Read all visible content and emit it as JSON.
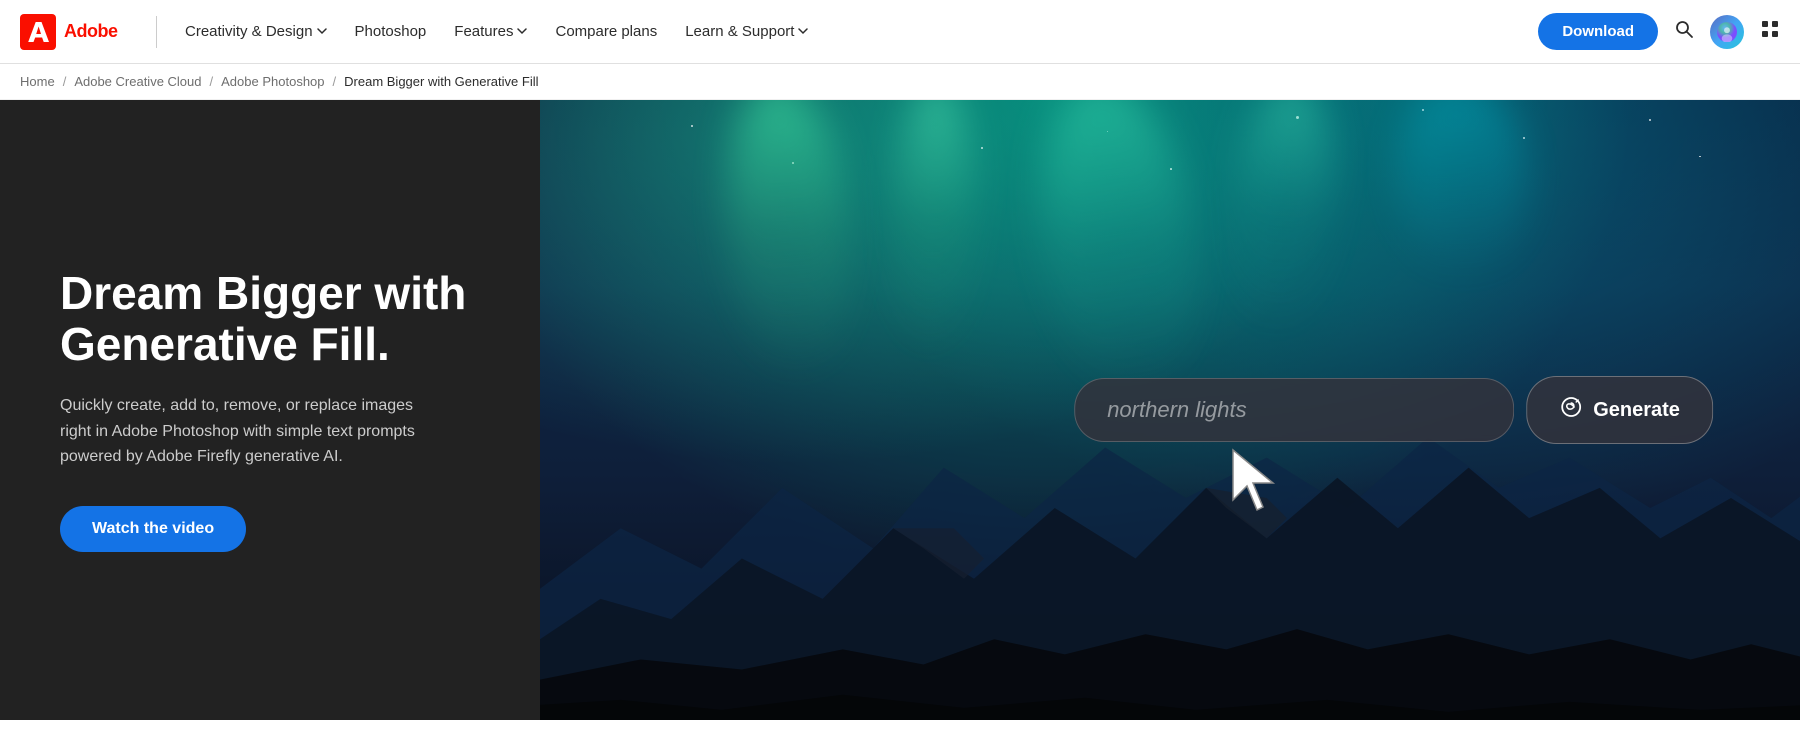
{
  "nav": {
    "brand": "Adobe",
    "divider": true,
    "links": [
      {
        "label": "Creativity & Design",
        "has_dropdown": true,
        "id": "creativity-design"
      },
      {
        "label": "Photoshop",
        "has_dropdown": false,
        "id": "photoshop"
      },
      {
        "label": "Features",
        "has_dropdown": true,
        "id": "features"
      },
      {
        "label": "Compare plans",
        "has_dropdown": false,
        "id": "compare-plans"
      },
      {
        "label": "Learn & Support",
        "has_dropdown": true,
        "id": "learn-support"
      }
    ],
    "download_label": "Download"
  },
  "breadcrumb": {
    "items": [
      {
        "label": "Home",
        "href": "#"
      },
      {
        "label": "Adobe Creative Cloud",
        "href": "#"
      },
      {
        "label": "Adobe Photoshop",
        "href": "#"
      },
      {
        "label": "Dream Bigger with Generative Fill",
        "href": null
      }
    ]
  },
  "hero": {
    "title": "Dream Bigger with Generative Fill.",
    "description": "Quickly create, add to, remove, or replace images right in Adobe Photoshop with simple text prompts powered by Adobe Firefly generative AI.",
    "cta_label": "Watch the video",
    "generate_input_value": "northern lights",
    "generate_input_placeholder": "northern lights",
    "generate_button_label": "Generate"
  },
  "icons": {
    "search": "🔍",
    "grid": "⊞",
    "chevron_down": "▾",
    "generate": "↺"
  }
}
